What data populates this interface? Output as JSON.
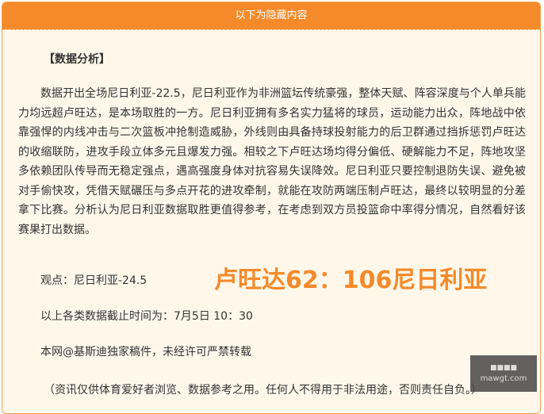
{
  "header": {
    "title": "以下为隐藏内容"
  },
  "article": {
    "section_title": "【数据分析】",
    "paragraph": "数据开出全场尼日利亚-22.5，尼日利亚作为非洲篮坛传统豪强，整体天赋、阵容深度与个人单兵能力均远超卢旺达，是本场取胜的一方。尼日利亚拥有多名实力猛将的球员，运动能力出众，阵地战中依靠强悍的内线冲击与二次篮板冲抢制造威胁，外线则由具备持球投射能力的后卫群通过挡拆惩罚卢旺达的收缩联防，进攻手段立体多元且爆发力强。相较之下卢旺达场均得分偏低、硬解能力不足，阵地攻坚多依赖团队传导而无稳定强点，遇高强度身体对抗容易失误降效。尼日利亚只要控制退防失误、避免被对手偷快攻，凭借天赋碾压与多点开花的进攻牵制，就能在攻防两端压制卢旺达，最终以较明显的分差拿下比赛。分析认为尼日利亚数据取胜更值得参考，在考虑到双方员投篮命中率得分情况，自然看好该赛果打出数据。",
    "viewpoint": "观点：尼日利亚-24.5",
    "score": "卢旺达62：106尼日利亚",
    "cutoff": "以上各类数据截止时间为：7月5日 10：30",
    "copyright": "本网@基斯迪独家稿件，未经许可严禁转载",
    "disclaimer": "（资讯仅供体育爱好者浏览、数据参考之用。任何人不得用于非法用途，否则责任自负。）"
  },
  "watermark": {
    "line1": "■■■■",
    "line2": "mawgt.com"
  }
}
